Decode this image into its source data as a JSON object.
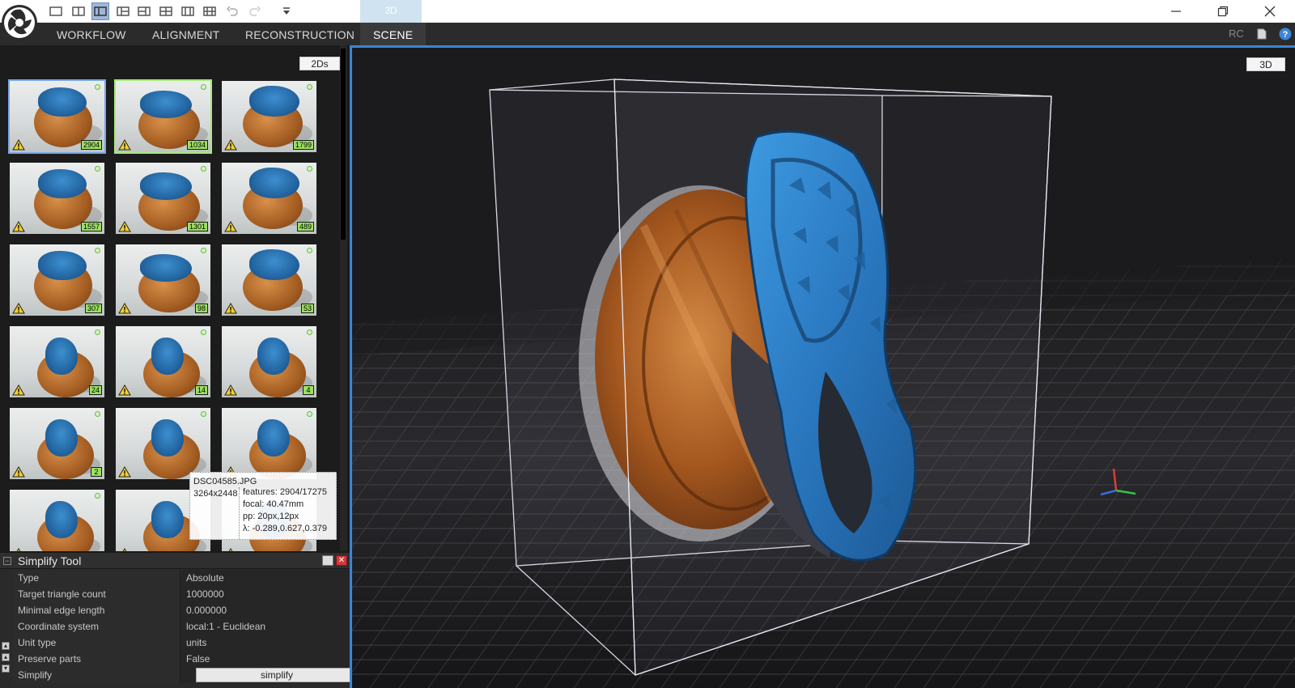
{
  "window": {
    "tab_3d_top": "3D",
    "controls": [
      "minimize",
      "restore",
      "close"
    ]
  },
  "menu": {
    "items": [
      "WORKFLOW",
      "ALIGNMENT",
      "RECONSTRUCTION",
      "SCENE"
    ],
    "active": "SCENE",
    "right_label": "RC"
  },
  "left_panel": {
    "label": "2Ds",
    "thumbnails": [
      {
        "count": "2904",
        "selected": "blue"
      },
      {
        "count": "1034",
        "selected": "green"
      },
      {
        "count": "1799"
      },
      {
        "count": "1557"
      },
      {
        "count": "1301"
      },
      {
        "count": "489"
      },
      {
        "count": "307"
      },
      {
        "count": "98"
      },
      {
        "count": "53"
      },
      {
        "count": "24"
      },
      {
        "count": "14"
      },
      {
        "count": "4"
      },
      {
        "count": "2"
      },
      {
        "count": ""
      },
      {
        "count": ""
      },
      {
        "count": ""
      },
      {
        "count": ""
      },
      {
        "count": ""
      }
    ]
  },
  "tooltip": {
    "filename": "DSC04585.JPG",
    "resolution": "3264x2448",
    "features": "features: 2904/17275",
    "focal": "focal: 40.47mm",
    "pp": "pp: 20px,12px",
    "lambda": "λ: -0.289,0.627,0.379"
  },
  "simplify_tool": {
    "title": "Simplify Tool",
    "rows": [
      {
        "key": "Type",
        "value": "Absolute"
      },
      {
        "key": "Target triangle count",
        "value": "1000000"
      },
      {
        "key": "Minimal edge length",
        "value": "0.000000"
      },
      {
        "key": "Coordinate system",
        "value": "local:1 - Euclidean"
      },
      {
        "key": "Unit type",
        "value": "units"
      },
      {
        "key": "Preserve parts",
        "value": "False"
      },
      {
        "key": "Simplify",
        "value": ""
      }
    ],
    "button_label": "simplify"
  },
  "viewport": {
    "label": "3D"
  },
  "colors": {
    "accent": "#3c84d6",
    "count_badge": "#9be060",
    "close": "#d23a3a"
  }
}
